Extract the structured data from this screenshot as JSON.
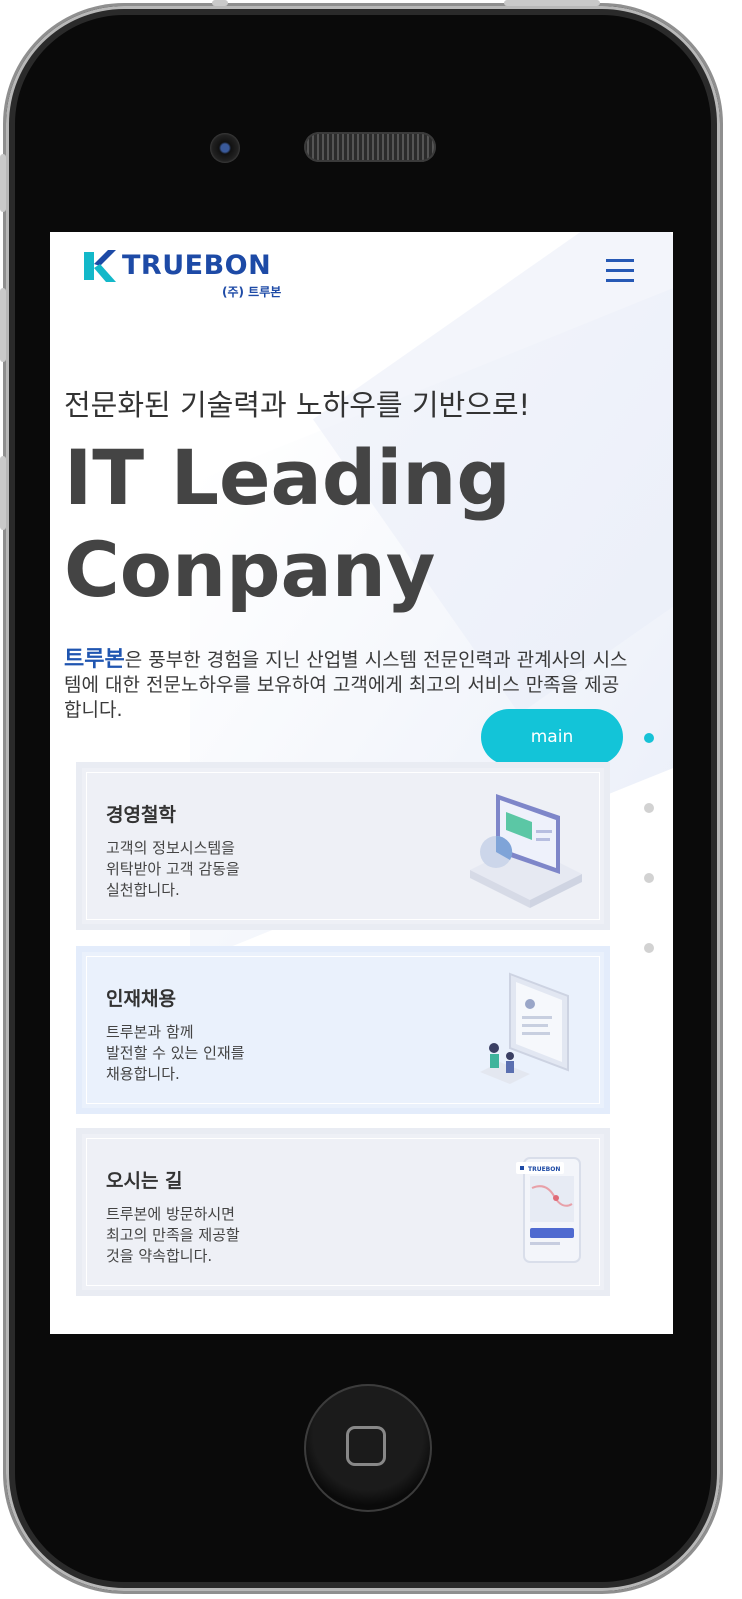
{
  "header": {
    "logo_text": "TRUEBON",
    "logo_sub": "(주) 트루본",
    "menu_icon": "hamburger-icon"
  },
  "hero": {
    "subtitle": "전문화된 기술력과 노하우를 기반으로!",
    "headline_line1": "IT Leading",
    "headline_line2": "Conpany",
    "desc_brand": "트루본",
    "desc_rest": "은 풍부한 경험을 지닌 산업별 시스템 전문인력과 관계사의 시스템에 대한 전문노하우를 보유하여 고객에게 최고의 서비스 만족을 제공합니다."
  },
  "nav": {
    "main_label": "main",
    "dots": [
      "active",
      "inactive",
      "inactive",
      "inactive"
    ]
  },
  "cards": [
    {
      "title": "경영철학",
      "text": "고객의 정보시스템을\n위탁받아 고객 감동을\n실천합니다.",
      "icon": "computer-monitor-illustration"
    },
    {
      "title": "인재채용",
      "text": "트루본과 함께\n발전할 수 있는 인재를\n채용합니다.",
      "icon": "tablet-people-illustration"
    },
    {
      "title": "오시는 길",
      "text": "트루본에 방문하시면\n최고의 만족을 제공할\n것을 약속합니다.",
      "icon": "map-phone-illustration",
      "mini_logo": "TRUEBON"
    }
  ],
  "colors": {
    "brand_blue": "#1d4aa6",
    "accent_cyan": "#13c4d8",
    "text_dark": "#444444"
  }
}
